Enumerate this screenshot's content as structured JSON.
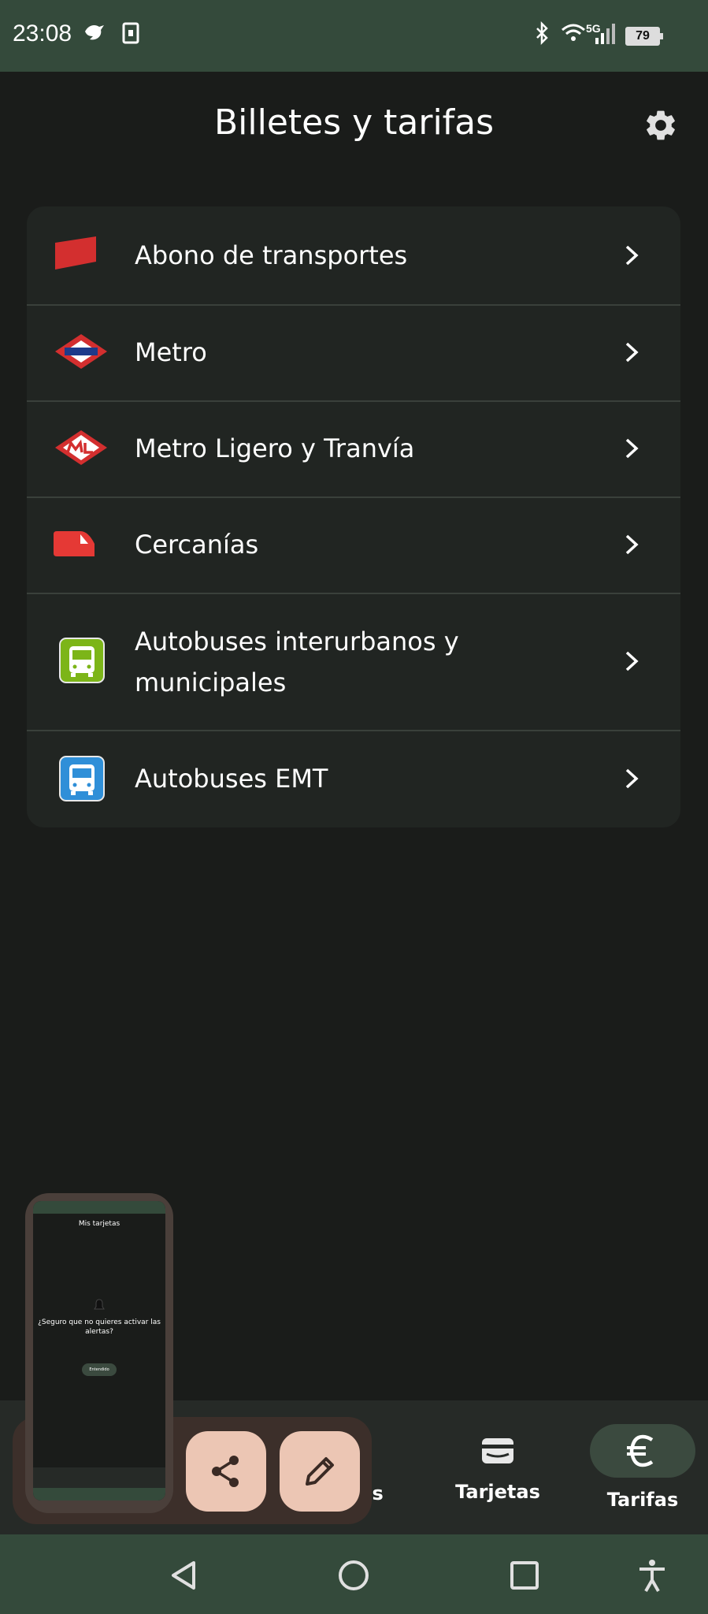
{
  "status_bar": {
    "time": "23:08",
    "network": "5G",
    "battery": "79"
  },
  "header": {
    "title": "Billetes y tarifas"
  },
  "fare_list": [
    {
      "label": "Abono de transportes",
      "icon": "transport-pass-icon",
      "color": "#d32f2f"
    },
    {
      "label": "Metro",
      "icon": "metro-logo-icon",
      "color": "#d32f2f"
    },
    {
      "label": "Metro Ligero y Tranvía",
      "icon": "light-rail-logo-icon",
      "color": "#d32f2f"
    },
    {
      "label": "Cercanías",
      "icon": "commuter-train-icon",
      "color": "#e53935"
    },
    {
      "label": "Autobuses interurbanos y municipales",
      "label_line1": "Autobuses interurbanos y",
      "label_line2": "municipales",
      "icon": "interurban-bus-icon",
      "color": "#7cb518"
    },
    {
      "label": "Autobuses EMT",
      "icon": "emt-bus-icon",
      "color": "#2f8fd8"
    }
  ],
  "bottom_nav": {
    "partial_label": "os",
    "cards_label": "Tarjetas",
    "fares_label": "Tarifas",
    "fares_icon": "euro-icon",
    "selected": "Tarifas"
  },
  "screenshot_preview": {
    "title": "Mis tarjetas",
    "message": "¿Seguro que no quieres activar las alertas?",
    "button": "Entendido"
  },
  "colors": {
    "background": "#1a1c1a",
    "status_bar": "#344a3b",
    "card": "#212522",
    "fab": "#ecc6b4",
    "selected_pill": "#3b4a3f"
  }
}
